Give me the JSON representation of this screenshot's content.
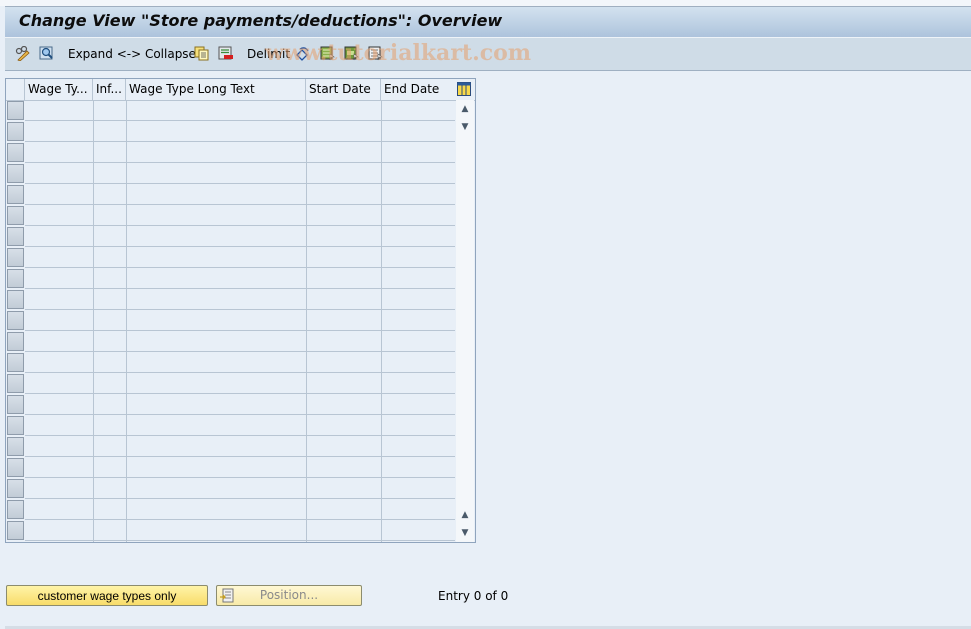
{
  "window": {
    "title": "Change View \"Store payments/deductions\": Overview"
  },
  "toolbar": {
    "items": [
      {
        "type": "icon",
        "name": "edit-glasses-pencil-icon"
      },
      {
        "type": "icon",
        "name": "search-details-icon"
      },
      {
        "type": "button",
        "label": "Expand <-> Collapse"
      },
      {
        "type": "icon",
        "name": "copy-icon"
      },
      {
        "type": "icon",
        "name": "delete-row-icon"
      },
      {
        "type": "button",
        "label": "Delimit"
      },
      {
        "type": "icon",
        "name": "undo-change-icon"
      },
      {
        "type": "icon",
        "name": "select-all-icon"
      },
      {
        "type": "icon",
        "name": "select-block-icon"
      },
      {
        "type": "icon",
        "name": "deselect-all-icon"
      }
    ],
    "watermark": "www.tutorialkart.com"
  },
  "table": {
    "columns": [
      {
        "label": "Wage Ty..."
      },
      {
        "label": "Inf..."
      },
      {
        "label": "Wage Type Long Text"
      },
      {
        "label": "Start Date"
      },
      {
        "label": "End Date"
      }
    ],
    "row_count": 21,
    "rows": []
  },
  "footer": {
    "customer_button": "customer wage types only",
    "position_button": "Position...",
    "entry_text": "Entry 0 of 0"
  }
}
